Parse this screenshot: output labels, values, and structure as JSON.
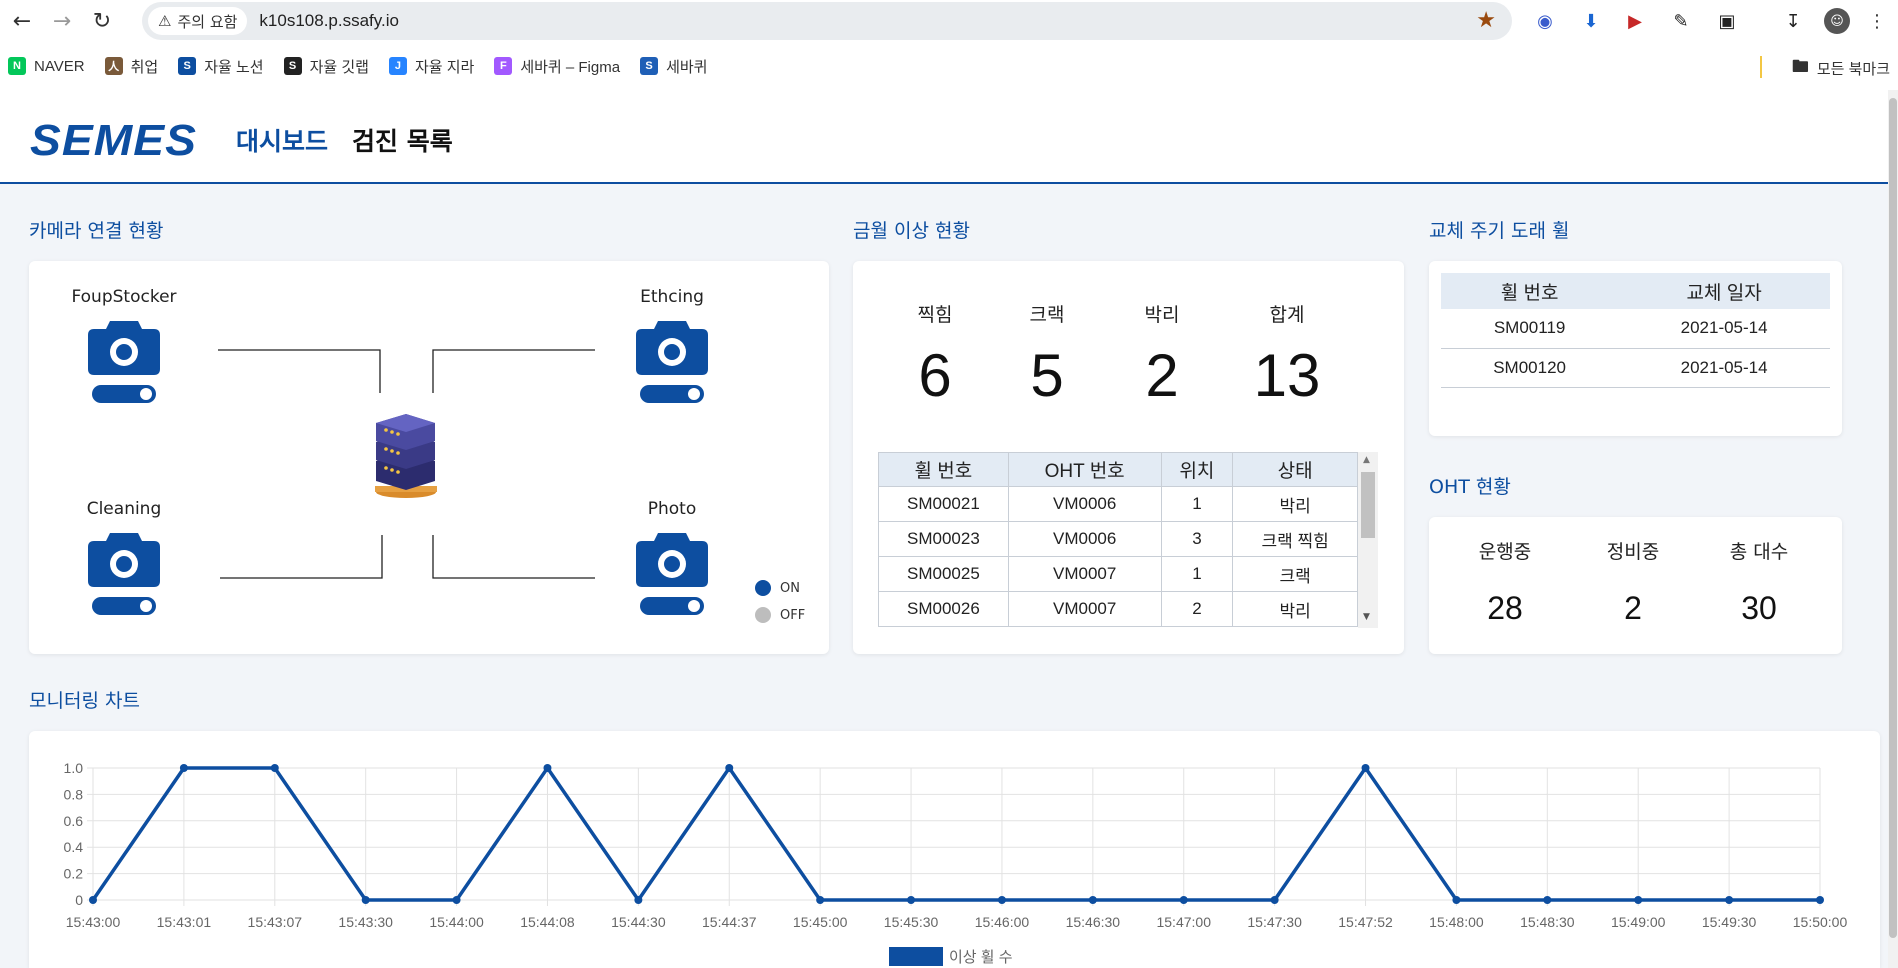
{
  "browser": {
    "site_chip": "주의 요함",
    "url": "k10s108.p.ssafy.io",
    "bookmarks": [
      {
        "label": "NAVER",
        "icon": "naver-icon",
        "color": "#03c75a",
        "glyph": "N"
      },
      {
        "label": "취업",
        "icon": "person-icon",
        "color": "#7a5a3a",
        "glyph": "人"
      },
      {
        "label": "자율 노션",
        "icon": "semes-icon",
        "color": "#0d4ea0",
        "glyph": "S"
      },
      {
        "label": "자율 깃랩",
        "icon": "gitlab-icon",
        "color": "#222222",
        "glyph": "S"
      },
      {
        "label": "자율 지라",
        "icon": "jira-icon",
        "color": "#2684ff",
        "glyph": "J"
      },
      {
        "label": "세바퀴 – Figma",
        "icon": "figma-icon",
        "color": "#a259ff",
        "glyph": "F"
      },
      {
        "label": "세바퀴",
        "icon": "semes-icon",
        "color": "#1f5fb6",
        "glyph": "S"
      }
    ],
    "all_bookmarks": "모든 북마크"
  },
  "header": {
    "logo": "SEMES",
    "nav": [
      "대시보드",
      "검진 목록"
    ]
  },
  "camera": {
    "title": "카메라 연결 현황",
    "cameras": [
      "FoupStocker",
      "Ethcing",
      "Cleaning",
      "Photo"
    ],
    "legend": [
      "ON",
      "OFF"
    ],
    "colors": {
      "on": "#0d4ea0",
      "off": "#bdbdbd"
    }
  },
  "anomaly": {
    "title": "금월 이상 현황",
    "stats": [
      {
        "label": "찍힘",
        "value": "6"
      },
      {
        "label": "크랙",
        "value": "5"
      },
      {
        "label": "박리",
        "value": "2"
      },
      {
        "label": "합계",
        "value": "13"
      }
    ],
    "table": {
      "headers": [
        "휠 번호",
        "OHT 번호",
        "위치",
        "상태"
      ],
      "rows": [
        [
          "SM00021",
          "VM0006",
          "1",
          "박리"
        ],
        [
          "SM00023",
          "VM0006",
          "3",
          "크랙 찍힘"
        ],
        [
          "SM00025",
          "VM0007",
          "1",
          "크랙"
        ],
        [
          "SM00026",
          "VM0007",
          "2",
          "박리"
        ]
      ]
    }
  },
  "replacement": {
    "title": "교체 주기 도래 휠",
    "headers": [
      "휠 번호",
      "교체 일자"
    ],
    "rows": [
      [
        "SM00119",
        "2021-05-14"
      ],
      [
        "SM00120",
        "2021-05-14"
      ]
    ]
  },
  "oht": {
    "title": "OHT 현황",
    "stats": [
      {
        "label": "운행중",
        "value": "28"
      },
      {
        "label": "정비중",
        "value": "2"
      },
      {
        "label": "총 대수",
        "value": "30"
      }
    ]
  },
  "monitoring": {
    "title": "모니터링 차트"
  },
  "chart_data": {
    "type": "line",
    "x": [
      "15:43:00",
      "15:43:01",
      "15:43:07",
      "15:43:30",
      "15:44:00",
      "15:44:08",
      "15:44:30",
      "15:44:37",
      "15:45:00",
      "15:45:30",
      "15:46:00",
      "15:46:30",
      "15:47:00",
      "15:47:30",
      "15:47:52",
      "15:48:00",
      "15:48:30",
      "15:49:00",
      "15:49:30",
      "15:50:00"
    ],
    "series": [
      {
        "name": "이상 휠 수",
        "values": [
          0,
          1,
          1,
          0,
          0,
          1,
          0,
          1,
          0,
          0,
          0,
          0,
          0,
          0,
          1,
          0,
          0,
          0,
          0,
          0
        ]
      }
    ],
    "y_ticks": [
      "0",
      "0.2",
      "0.4",
      "0.6",
      "0.8",
      "1.0"
    ],
    "ylim": [
      0,
      1
    ],
    "grid": true,
    "legend": "bottom",
    "color": "#0d4ea0"
  }
}
